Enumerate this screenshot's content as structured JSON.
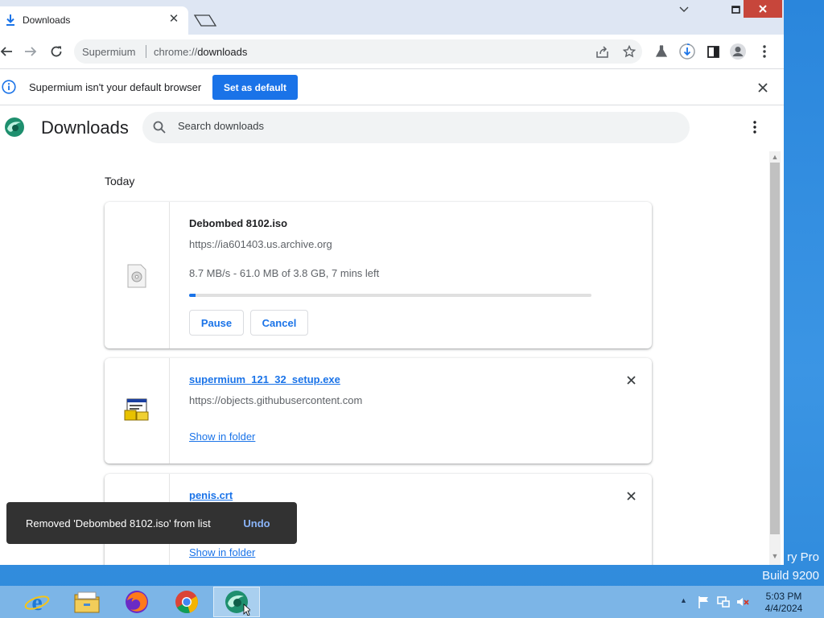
{
  "desktop": {
    "watermark_line1": "ry Pro",
    "watermark_line2": "Build 9200"
  },
  "tab": {
    "title": "Downloads",
    "close_glyph": "✕"
  },
  "window_controls": {
    "minimize": "—",
    "maximize": "□",
    "close": "✕"
  },
  "toolbar": {
    "omnibox_site": "Supermium",
    "url_scheme": "chrome://",
    "url_path": "downloads"
  },
  "infobar": {
    "message": "Supermium isn't your default browser",
    "set_default_label": "Set as default"
  },
  "downloads_page": {
    "title": "Downloads",
    "search_placeholder": "Search downloads",
    "section_today": "Today",
    "items": [
      {
        "name": "Debombed 8102.iso",
        "url": "https://ia601403.us.archive.org",
        "status": "8.7 MB/s - 61.0 MB of 3.8 GB, 7 mins left",
        "progress_fraction": 0.016,
        "pause_label": "Pause",
        "cancel_label": "Cancel"
      },
      {
        "name": "supermium_121_32_setup.exe",
        "url": "https://objects.githubusercontent.com",
        "show_in_folder": "Show in folder"
      },
      {
        "name": "penis.crt",
        "show_in_folder": "Show in folder"
      }
    ]
  },
  "toast": {
    "message": "Removed 'Debombed 8102.iso' from list",
    "undo_label": "Undo"
  },
  "taskbar": {
    "time": "5:03 PM",
    "date": "4/4/2024"
  },
  "colors": {
    "accent": "#1a73e8",
    "toast_bg": "#323232",
    "close_red": "#c7463b"
  }
}
